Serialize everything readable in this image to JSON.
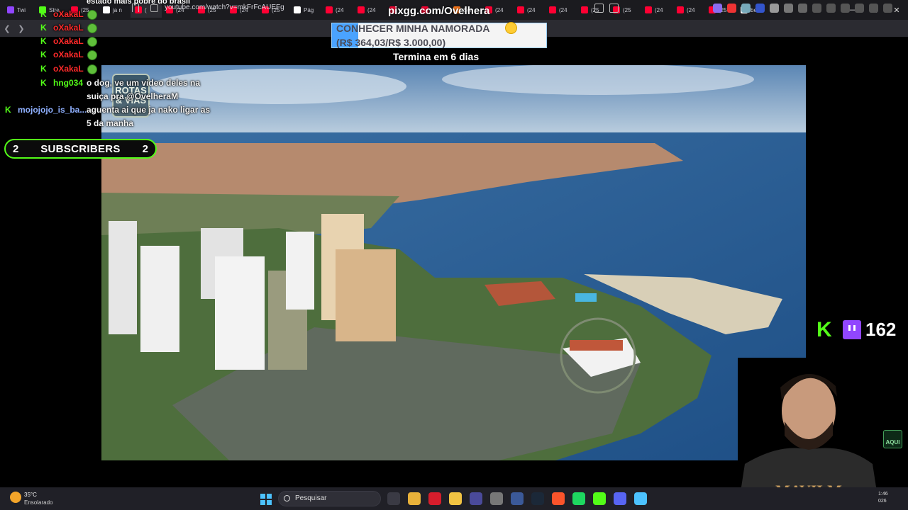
{
  "browser": {
    "tabs": [
      {
        "label": "Twi",
        "icon": "twitch-icon",
        "color": "#9146ff"
      },
      {
        "label": "Stre",
        "icon": "kick-icon",
        "color": "#53fc18"
      },
      {
        "label": "(25",
        "icon": "youtube-icon",
        "color": "#ff0033"
      },
      {
        "label": "ja n",
        "icon": "x-icon",
        "color": "#ffffff"
      },
      {
        "label": "(",
        "icon": "youtube-icon",
        "color": "#ff0033"
      },
      {
        "label": "(24",
        "icon": "youtube-icon",
        "color": "#ff0033"
      },
      {
        "label": "(25",
        "icon": "youtube-icon",
        "color": "#ff0033"
      },
      {
        "label": "(24",
        "icon": "youtube-icon",
        "color": "#ff0033"
      },
      {
        "label": "(25",
        "icon": "youtube-icon",
        "color": "#ff0033"
      },
      {
        "label": "Pág",
        "icon": "x-icon",
        "color": "#ffffff"
      },
      {
        "label": "(24",
        "icon": "youtube-icon",
        "color": "#ff0033"
      },
      {
        "label": "(24",
        "icon": "youtube-icon",
        "color": "#ff0033"
      },
      {
        "label": "",
        "icon": "youtube-icon",
        "color": "#ff0033"
      },
      {
        "label": "",
        "icon": "youtube-icon",
        "color": "#ff0033"
      },
      {
        "label": "Sor",
        "icon": "orange-icon",
        "color": "#ff7a1a"
      },
      {
        "label": "(24",
        "icon": "youtube-icon",
        "color": "#ff0033"
      },
      {
        "label": "(24",
        "icon": "youtube-icon",
        "color": "#ff0033"
      },
      {
        "label": "(24",
        "icon": "youtube-icon",
        "color": "#ff0033"
      },
      {
        "label": "(25",
        "icon": "youtube-icon",
        "color": "#ff0033"
      },
      {
        "label": "(25",
        "icon": "youtube-icon",
        "color": "#ff0033"
      },
      {
        "label": "(24",
        "icon": "youtube-icon",
        "color": "#ff0033"
      },
      {
        "label": "(24",
        "icon": "youtube-icon",
        "color": "#ff0033"
      },
      {
        "label": "(25",
        "icon": "youtube-icon",
        "color": "#ff0033"
      },
      {
        "label": "bei",
        "icon": "google-icon",
        "color": "#ffffff"
      }
    ],
    "new_tab": "+",
    "url": "youtube.com/watch?v=mkFrFcAUEFg"
  },
  "overlay": {
    "top_message": "estado mais pobre do brasil",
    "pix_url": "pixgg.com/Ovelhera",
    "goal_title": "CONHECER MINHA NAMORADA",
    "goal_amount": "(R$ 364,03/R$ 3.000,00)",
    "goal_progress": 0.121,
    "goal_ends": "Termina em 6 dias",
    "watermark": "ROTAS & VIAS"
  },
  "chat": {
    "messages": [
      {
        "user": "oXakaL",
        "user_color": "#ff2a2a"
      },
      {
        "user": "oXakaL",
        "user_color": "#ff2a2a"
      },
      {
        "user": "oXakaL",
        "user_color": "#ff2a2a"
      },
      {
        "user": "oXakaL",
        "user_color": "#ff2a2a"
      },
      {
        "user": "oXakaL",
        "user_color": "#ff2a2a"
      },
      {
        "user": "hng034",
        "user_color": "#53fc18",
        "text": "o dog, ve um video deles na suiça pra @OvelheraM"
      },
      {
        "user": "mojojojo_is_ba...",
        "user_color": "#8fb0ff",
        "text": "aguenta ai que ja nako ligar as 5 da manha"
      }
    ]
  },
  "subscribers": {
    "left_count": "2",
    "label": "SUBSCRIBERS",
    "right_count": "2"
  },
  "viewers": {
    "count": "162"
  },
  "webcam": {
    "shirt_text": "MAVILM"
  },
  "aqui_badge": "AQUI",
  "taskbar": {
    "weather_temp": "35°C",
    "weather_desc": "Ensolarado",
    "search_placeholder": "Pesquisar",
    "clock_time": "1:46",
    "clock_date": "026"
  }
}
